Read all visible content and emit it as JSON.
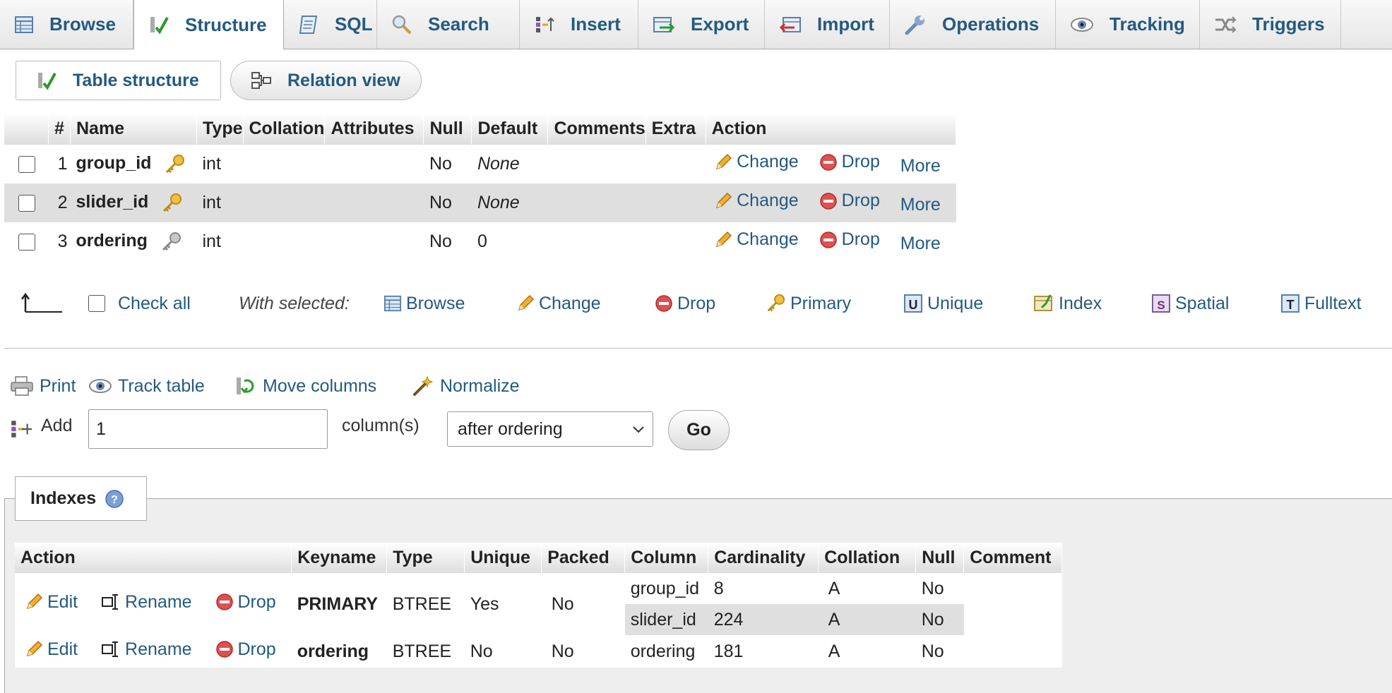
{
  "tabs": [
    {
      "label": "Browse",
      "icon": "browse-icon"
    },
    {
      "label": "Structure",
      "icon": "structure-icon",
      "active": true
    },
    {
      "label": "SQL",
      "icon": "sql-icon"
    },
    {
      "label": "Search",
      "icon": "search-icon"
    },
    {
      "label": "Insert",
      "icon": "insert-icon"
    },
    {
      "label": "Export",
      "icon": "export-icon"
    },
    {
      "label": "Import",
      "icon": "import-icon"
    },
    {
      "label": "Operations",
      "icon": "wrench-icon"
    },
    {
      "label": "Tracking",
      "icon": "eye-icon"
    },
    {
      "label": "Triggers",
      "icon": "triggers-icon"
    }
  ],
  "subtabs": {
    "table_structure": "Table structure",
    "relation_view": "Relation view"
  },
  "structure": {
    "headers": [
      "#",
      "Name",
      "Type",
      "Collation",
      "Attributes",
      "Null",
      "Default",
      "Comments",
      "Extra",
      "Action"
    ],
    "rows": [
      {
        "num": "1",
        "name": "group_id",
        "key": "primary",
        "type": "int",
        "null": "No",
        "default": "None",
        "default_italic": true
      },
      {
        "num": "2",
        "name": "slider_id",
        "key": "primary",
        "type": "int",
        "null": "No",
        "default": "None",
        "default_italic": true
      },
      {
        "num": "3",
        "name": "ordering",
        "key": "index",
        "type": "int",
        "null": "No",
        "default": "0",
        "default_italic": false
      }
    ],
    "row_actions": {
      "change": "Change",
      "drop": "Drop",
      "more": "More"
    }
  },
  "with_selected": {
    "check_all": "Check all",
    "label": "With selected:",
    "actions": [
      "Browse",
      "Change",
      "Drop",
      "Primary",
      "Unique",
      "Index",
      "Spatial",
      "Fulltext"
    ]
  },
  "tools": {
    "print": "Print",
    "track": "Track table",
    "move": "Move columns",
    "normalize": "Normalize"
  },
  "add": {
    "label": "Add",
    "value": "1",
    "unit": "column(s)",
    "position": "after ordering",
    "go": "Go"
  },
  "indexes": {
    "title": "Indexes",
    "headers": [
      "Action",
      "Keyname",
      "Type",
      "Unique",
      "Packed",
      "Column",
      "Cardinality",
      "Collation",
      "Null",
      "Comment"
    ],
    "actions": {
      "edit": "Edit",
      "rename": "Rename",
      "drop": "Drop"
    },
    "rows": [
      {
        "keyname": "PRIMARY",
        "type": "BTREE",
        "unique": "Yes",
        "packed": "No",
        "columns": [
          {
            "column": "group_id",
            "cardinality": "8",
            "collation": "A",
            "null": "No"
          },
          {
            "column": "slider_id",
            "cardinality": "224",
            "collation": "A",
            "null": "No"
          }
        ]
      },
      {
        "keyname": "ordering",
        "type": "BTREE",
        "unique": "No",
        "packed": "No",
        "columns": [
          {
            "column": "ordering",
            "cardinality": "181",
            "collation": "A",
            "null": "No"
          }
        ]
      }
    ]
  }
}
